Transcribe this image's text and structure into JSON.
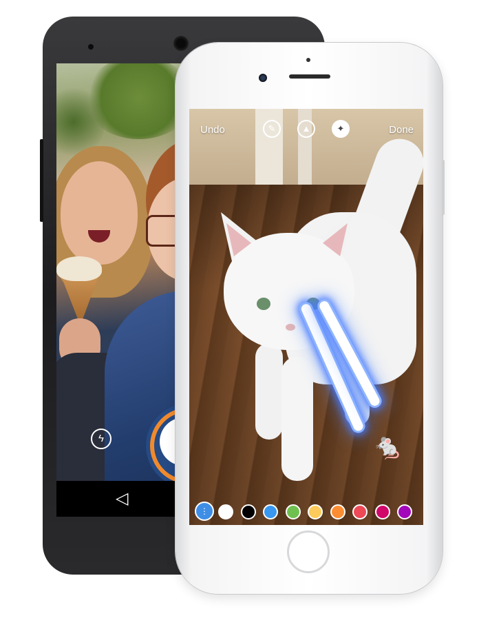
{
  "ios_editor": {
    "toolbar": {
      "undo_label": "Undo",
      "done_label": "Done",
      "tools": [
        {
          "name": "pen-tool",
          "glyph": "✎"
        },
        {
          "name": "marker-tool",
          "glyph": "▲"
        },
        {
          "name": "neon-tool",
          "glyph": "✦"
        }
      ]
    },
    "sticker": "🐁",
    "palette": {
      "brush_size_glyph": "⋮",
      "colors": [
        "#ffffff",
        "#000000",
        "#3897f0",
        "#70c050",
        "#fdcb5c",
        "#fd8d32",
        "#ed4956",
        "#d10869",
        "#a307ba"
      ]
    },
    "laser_color": "#4f86ff"
  },
  "android_camera": {
    "flash_glyph": "ϟ",
    "back_glyph": "◁",
    "shutter_ring_color": "#f08a2d"
  }
}
